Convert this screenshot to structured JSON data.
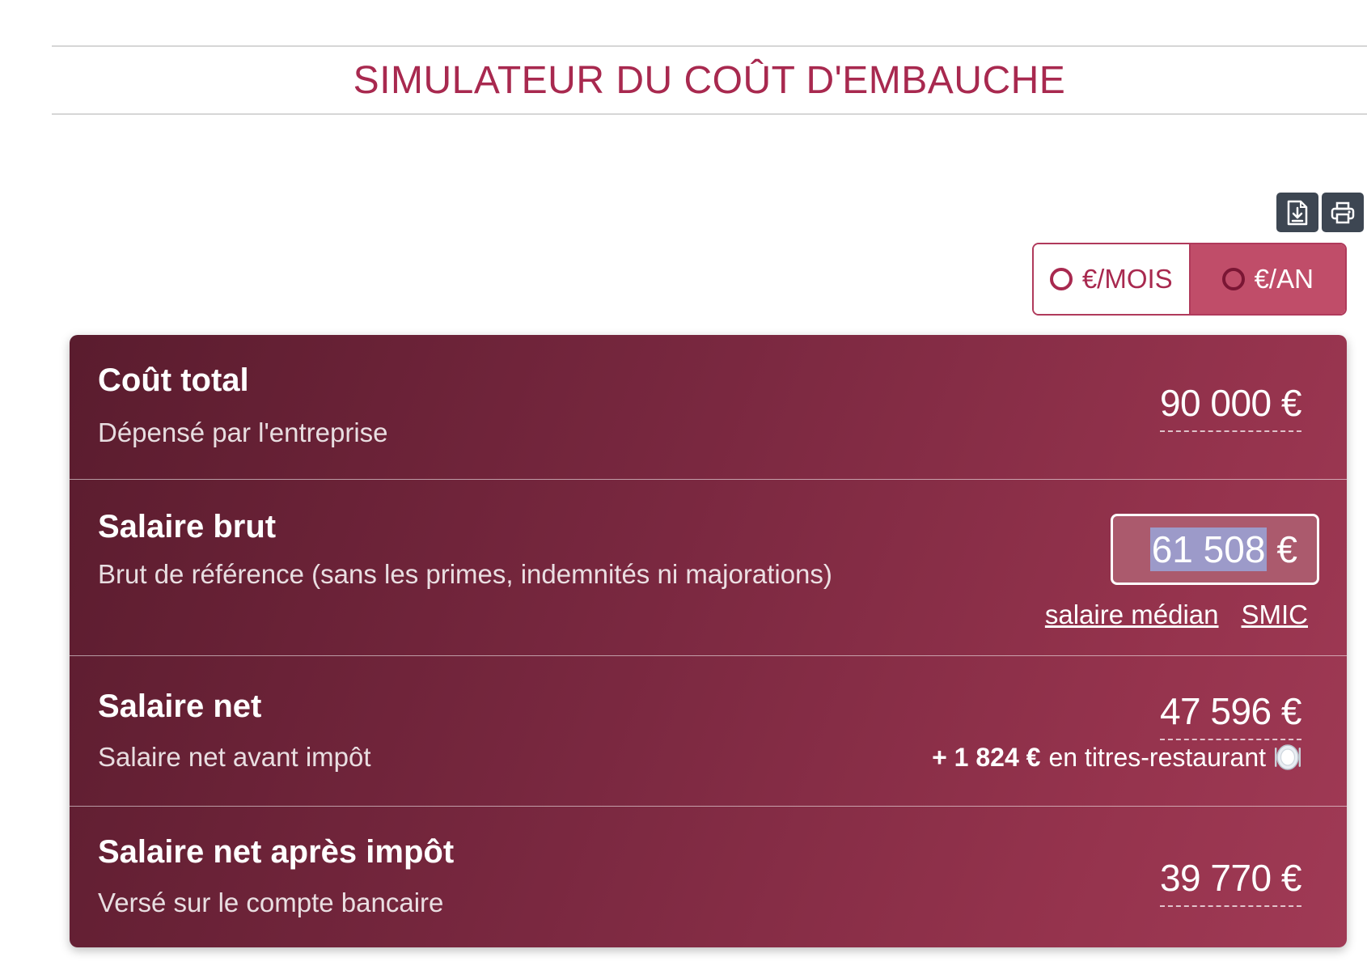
{
  "header": {
    "title": "SIMULATEUR DU COÛT D'EMBAUCHE"
  },
  "toolbar": {
    "download_icon": "file-download-icon",
    "print_icon": "printer-icon"
  },
  "period_toggle": {
    "month_label": "€/MOIS",
    "year_label": "€/AN",
    "selected": "€/AN"
  },
  "results": {
    "total_cost": {
      "title": "Coût total",
      "subtitle": "Dépensé par l'entreprise",
      "amount": "90 000 €"
    },
    "gross_salary": {
      "title": "Salaire brut",
      "subtitle": "Brut de référence (sans les primes, indemnités ni majorations)",
      "value": "61 508",
      "currency": "€",
      "links": {
        "median": "salaire médian",
        "smic": "SMIC"
      }
    },
    "net_salary": {
      "title": "Salaire net",
      "subtitle": "Salaire net avant impôt",
      "amount": "47 596 €",
      "meal_vouchers": {
        "amount": "+ 1 824 €",
        "label": "en titres-restaurant",
        "icon": "plate-icon"
      }
    },
    "net_after_tax": {
      "title": "Salaire net après impôt",
      "subtitle": "Versé sur le compte bancaire",
      "amount": "39 770 €"
    }
  },
  "colors": {
    "accent": "#a8294f",
    "toggle_active": "#c04d69",
    "card_dark": "#5a1c2e",
    "card_light": "#a03a55",
    "toolbar_button": "#3d4652"
  }
}
